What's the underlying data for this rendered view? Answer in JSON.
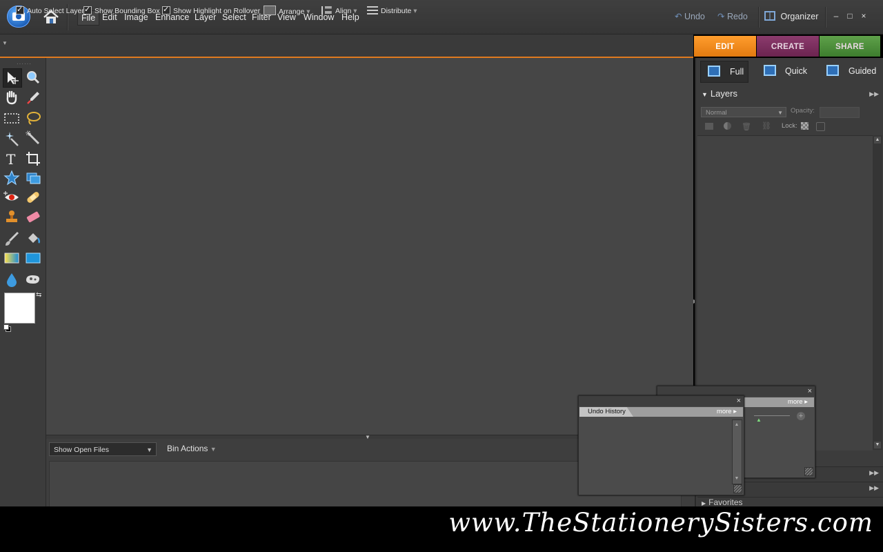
{
  "menubar": {
    "items": [
      "File",
      "Edit",
      "Image",
      "Enhance",
      "Layer",
      "Select",
      "Filter",
      "View",
      "Window",
      "Help"
    ],
    "undo": "Undo",
    "redo": "Redo",
    "organizer": "Organizer",
    "window_controls": [
      "–",
      "□",
      "×"
    ]
  },
  "options_bar": {
    "auto_select_layer": "Auto Select Layer",
    "show_bounding_box": "Show Bounding Box",
    "show_highlight": "Show Highlight on Rollover",
    "arrange": "Arrange",
    "align": "Align",
    "distribute": "Distribute"
  },
  "mode_tabs": {
    "edit": "EDIT",
    "create": "CREATE",
    "share": "SHARE"
  },
  "edit_modes": {
    "full": "Full",
    "quick": "Quick",
    "guided": "Guided"
  },
  "layers_panel": {
    "title": "Layers",
    "blend_mode": "Normal",
    "opacity_label": "Opacity:",
    "lock_label": "Lock:"
  },
  "project_bin": {
    "show_select": "Show Open Files",
    "bin_actions": "Bin Actions"
  },
  "undo_history": {
    "tab": "Undo History",
    "more": "more"
  },
  "back_panel": {
    "more": "more"
  },
  "favorites": "Favorites",
  "watermark": "www.TheStationerySisters.com",
  "colors": {
    "accent_edit": "#f08c1c",
    "accent_create": "#7a2e5c",
    "accent_share": "#4e9139"
  }
}
